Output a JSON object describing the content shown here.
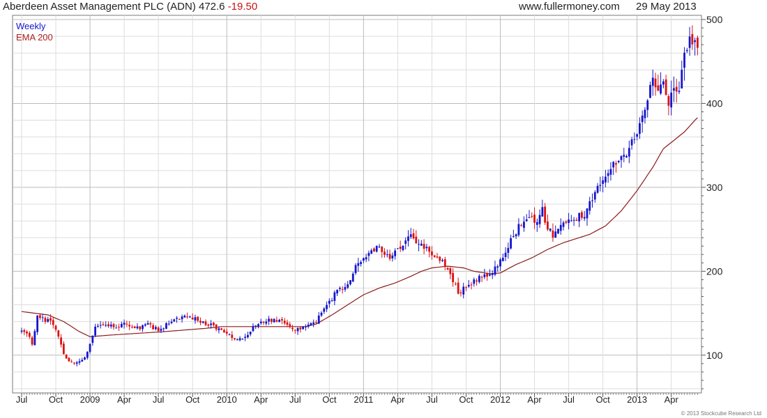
{
  "header": {
    "title": "Aberdeen Asset Management PLC (ADN) 472.6",
    "change": "-19.50",
    "site": "www.fullermoney.com",
    "date": "29 May 2013"
  },
  "legend": {
    "period": "Weekly",
    "ema": "EMA 200"
  },
  "footer": "© 2013 Stockcube Research Ltd",
  "colors": {
    "up": "#1515cc",
    "down": "#dd1111",
    "ema": "#8b1a1a",
    "grid": "#dddddd",
    "gridMajor": "#bbbbbb",
    "axis": "#555555"
  },
  "chart_data": {
    "type": "candlestick",
    "title": "Aberdeen Asset Management PLC (ADN) 472.6 -19.50",
    "ylim": [
      55,
      505
    ],
    "yticks": [
      100,
      200,
      300,
      400,
      500
    ],
    "ylabels": [
      "100",
      "200",
      "300",
      "400",
      "500"
    ],
    "xticks": [
      {
        "week": 0,
        "label": "Jul"
      },
      {
        "week": 13,
        "label": "Oct"
      },
      {
        "week": 26,
        "label": "2009"
      },
      {
        "week": 39,
        "label": "Apr"
      },
      {
        "week": 52,
        "label": "Jul"
      },
      {
        "week": 65,
        "label": "Oct"
      },
      {
        "week": 78,
        "label": "2010"
      },
      {
        "week": 91,
        "label": "Apr"
      },
      {
        "week": 104,
        "label": "Jul"
      },
      {
        "week": 117,
        "label": "Oct"
      },
      {
        "week": 130,
        "label": "2011"
      },
      {
        "week": 143,
        "label": "Apr"
      },
      {
        "week": 156,
        "label": "Jul"
      },
      {
        "week": 169,
        "label": "Oct"
      },
      {
        "week": 182,
        "label": "2012"
      },
      {
        "week": 195,
        "label": "Apr"
      },
      {
        "week": 208,
        "label": "Jul"
      },
      {
        "week": 221,
        "label": "Oct"
      },
      {
        "week": 234,
        "label": "2013"
      },
      {
        "week": 247,
        "label": "Apr"
      }
    ],
    "major_xticks": [
      "2009",
      "2010",
      "2011",
      "2012",
      "2013"
    ],
    "close_anchors": [
      [
        0,
        128
      ],
      [
        3,
        122
      ],
      [
        4,
        112
      ],
      [
        6,
        145
      ],
      [
        9,
        142
      ],
      [
        12,
        138
      ],
      [
        15,
        112
      ],
      [
        16,
        100
      ],
      [
        18,
        94
      ],
      [
        20,
        90
      ],
      [
        22,
        92
      ],
      [
        24,
        98
      ],
      [
        26,
        112
      ],
      [
        28,
        132
      ],
      [
        32,
        136
      ],
      [
        36,
        134
      ],
      [
        40,
        138
      ],
      [
        44,
        132
      ],
      [
        48,
        136
      ],
      [
        52,
        130
      ],
      [
        56,
        138
      ],
      [
        60,
        144
      ],
      [
        64,
        146
      ],
      [
        68,
        140
      ],
      [
        72,
        136
      ],
      [
        76,
        128
      ],
      [
        78,
        124
      ],
      [
        82,
        120
      ],
      [
        84,
        118
      ],
      [
        88,
        134
      ],
      [
        92,
        140
      ],
      [
        96,
        142
      ],
      [
        100,
        138
      ],
      [
        104,
        130
      ],
      [
        108,
        136
      ],
      [
        112,
        140
      ],
      [
        116,
        160
      ],
      [
        120,
        176
      ],
      [
        124,
        186
      ],
      [
        128,
        210
      ],
      [
        132,
        222
      ],
      [
        136,
        228
      ],
      [
        140,
        218
      ],
      [
        144,
        230
      ],
      [
        148,
        240
      ],
      [
        152,
        232
      ],
      [
        156,
        222
      ],
      [
        160,
        212
      ],
      [
        164,
        190
      ],
      [
        166,
        174
      ],
      [
        170,
        184
      ],
      [
        174,
        192
      ],
      [
        178,
        196
      ],
      [
        182,
        212
      ],
      [
        186,
        238
      ],
      [
        190,
        258
      ],
      [
        194,
        262
      ],
      [
        196,
        258
      ],
      [
        198,
        272
      ],
      [
        200,
        250
      ],
      [
        202,
        244
      ],
      [
        206,
        254
      ],
      [
        210,
        262
      ],
      [
        214,
        268
      ],
      [
        218,
        294
      ],
      [
        222,
        318
      ],
      [
        226,
        332
      ],
      [
        230,
        340
      ],
      [
        234,
        362
      ],
      [
        238,
        408
      ],
      [
        240,
        424
      ],
      [
        244,
        420
      ],
      [
        246,
        404
      ],
      [
        248,
        418
      ],
      [
        250,
        408
      ],
      [
        252,
        458
      ],
      [
        254,
        472
      ],
      [
        255,
        478
      ],
      [
        256,
        482
      ],
      [
        257,
        472.6
      ]
    ],
    "ema_anchors": [
      [
        0,
        152
      ],
      [
        10,
        148
      ],
      [
        16,
        140
      ],
      [
        22,
        128
      ],
      [
        26,
        122
      ],
      [
        34,
        124
      ],
      [
        44,
        126
      ],
      [
        54,
        128
      ],
      [
        62,
        130
      ],
      [
        70,
        132
      ],
      [
        76,
        134
      ],
      [
        82,
        134
      ],
      [
        90,
        134
      ],
      [
        100,
        134
      ],
      [
        108,
        134
      ],
      [
        112,
        137
      ],
      [
        118,
        148
      ],
      [
        124,
        160
      ],
      [
        130,
        172
      ],
      [
        136,
        180
      ],
      [
        142,
        186
      ],
      [
        148,
        194
      ],
      [
        152,
        200
      ],
      [
        156,
        204
      ],
      [
        162,
        206
      ],
      [
        168,
        204
      ],
      [
        172,
        200
      ],
      [
        178,
        197
      ],
      [
        182,
        198
      ],
      [
        188,
        208
      ],
      [
        194,
        216
      ],
      [
        200,
        226
      ],
      [
        206,
        234
      ],
      [
        212,
        240
      ],
      [
        216,
        244
      ],
      [
        222,
        254
      ],
      [
        228,
        272
      ],
      [
        234,
        296
      ],
      [
        240,
        324
      ],
      [
        244,
        346
      ],
      [
        248,
        356
      ],
      [
        252,
        366
      ],
      [
        256,
        380
      ],
      [
        257,
        383
      ]
    ]
  }
}
